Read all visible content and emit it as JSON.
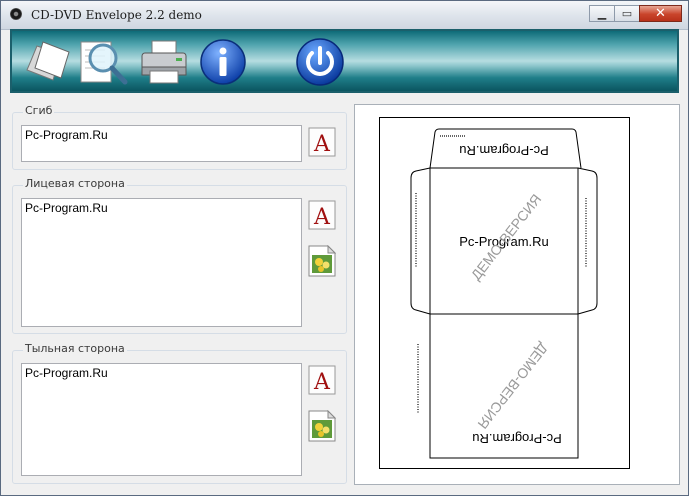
{
  "window": {
    "title": "CD-DVD Envelope 2.2 demo",
    "controls": {
      "minimize_icon": "minimize-icon",
      "maximize_icon": "maximize-icon",
      "close_icon": "close-icon"
    }
  },
  "toolbar": {
    "buttons": [
      {
        "name": "new-button",
        "icon": "blank-pages-icon"
      },
      {
        "name": "preview-button",
        "icon": "magnifier-icon"
      },
      {
        "name": "print-button",
        "icon": "printer-icon"
      },
      {
        "name": "info-button",
        "icon": "info-icon"
      },
      {
        "name": "exit-button",
        "icon": "power-icon"
      }
    ]
  },
  "sections": {
    "fold": {
      "label": "Сгиб",
      "value": "Pc-Program.Ru"
    },
    "front": {
      "label": "Лицевая сторона",
      "value": "Pc-Program.Ru"
    },
    "back": {
      "label": "Тыльная сторона",
      "value": "Pc-Program.Ru"
    }
  },
  "preview": {
    "fold_text": "Pc-Program.Ru",
    "front_text": "Pc-Program.Ru",
    "back_text": "Pc-Program.Ru",
    "watermark": "ДЕМО-ВЕРСИЯ"
  },
  "colors": {
    "toolbar_dark": "#0e6b78",
    "toolbar_light": "#b6dde1",
    "font_icon_red": "#a01010"
  }
}
